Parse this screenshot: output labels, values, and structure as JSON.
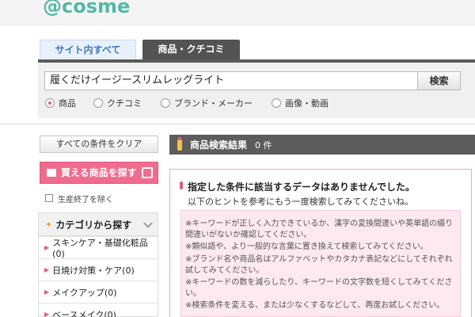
{
  "header": {
    "logo_text": "@cosme"
  },
  "search": {
    "tabs": [
      {
        "label": "サイト内すべて"
      },
      {
        "label": "商品・クチコミ"
      }
    ],
    "query": "履くだけイージースリムレッグライト",
    "button_label": "検索",
    "radio_options": [
      {
        "label": "商品",
        "selected": true
      },
      {
        "label": "クチコミ",
        "selected": false
      },
      {
        "label": "ブランド・メーカー",
        "selected": false
      },
      {
        "label": "画像・動画",
        "selected": false
      }
    ]
  },
  "sidebar": {
    "clear_label": "すべての条件をクリア",
    "buyable_label": "買える商品を探す",
    "exclude_discontinued_label": "生産終了を除く",
    "category_header": "カテゴリから探す",
    "categories": [
      {
        "label": "スキンケア・基礎化粧品(0)"
      },
      {
        "label": "日焼け対策・ケア(0)"
      },
      {
        "label": "メイクアップ(0)"
      },
      {
        "label": "ベースメイク(0)"
      }
    ]
  },
  "results": {
    "title": "商品検索結果",
    "count": "0 件",
    "no_results_title": "指定した条件に該当するデータはありませんでした。",
    "no_results_sub": "以下のヒントを参考にもう一度検索してみてくださいね。",
    "hints": [
      "※キーワードが正しく入力できているか、漢字の変換間違いや英単語の綴り間違いがないか確認してください。",
      "※類似語や、より一般的な言葉に置き換えて検索してみてください。",
      "※ブランド名や商品名はアルファベットやカタカナ表記などにしてそれぞれ試してみてください。",
      "※キーワードの数を減らしたり、キーワードの文字数を短くしてみてください。",
      "※検索条件を変える、または少なくするなどして、再度お試しください。"
    ]
  },
  "colors": {
    "brand": "#54b9a4",
    "accent_pink": "#f06c8f",
    "tab_dark": "#535353",
    "tab_blue": "#3a78c3"
  }
}
